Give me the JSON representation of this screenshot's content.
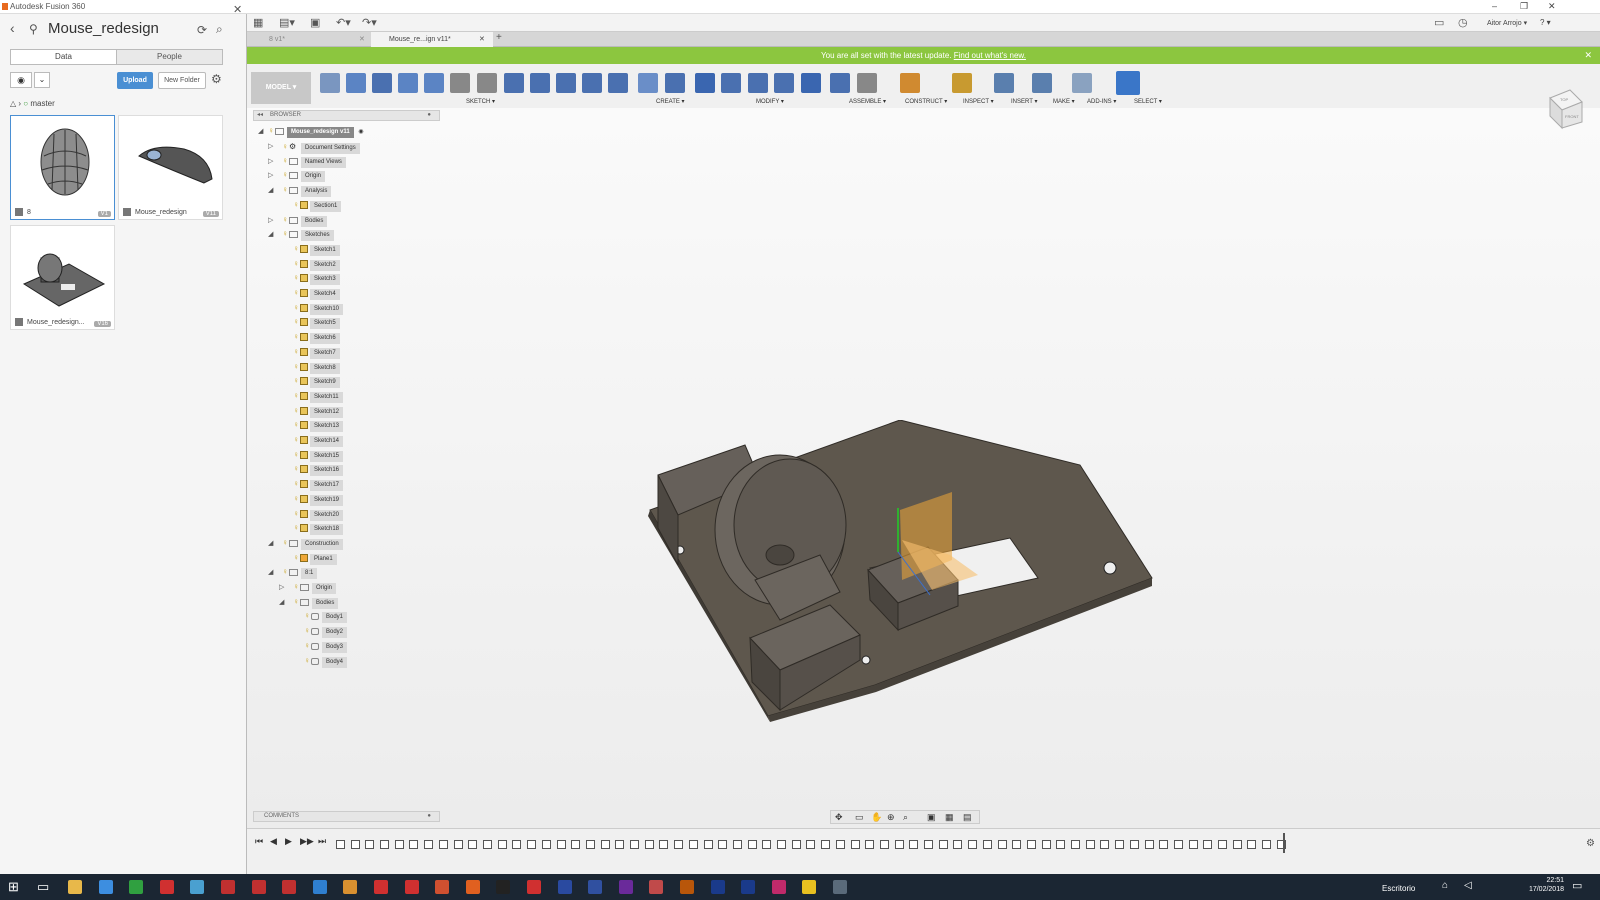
{
  "app_title": "Autodesk Fusion 360",
  "data_panel": {
    "title": "Mouse_redesign",
    "tabs": [
      "Data",
      "People"
    ],
    "upload_label": "Upload",
    "new_folder_label": "New Folder",
    "breadcrumb": "master",
    "items": [
      {
        "name": "8",
        "version": "V1"
      },
      {
        "name": "Mouse_redesign",
        "version": "V11"
      },
      {
        "name": "Mouse_redesign...",
        "version": "V16"
      }
    ]
  },
  "topbar": {
    "user": "Aitor Arrojo ▾",
    "help": "? ▾"
  },
  "doc_tabs": [
    {
      "label": "8 v1*"
    },
    {
      "label": "Mouse_re...ign v11*"
    }
  ],
  "update_bar": {
    "text": "You are all set with the latest update.",
    "link": "Find out what's new."
  },
  "toolbar": {
    "workspace": "MODEL ▾",
    "groups": [
      "SKETCH ▾",
      "CREATE ▾",
      "MODIFY ▾",
      "ASSEMBLE ▾",
      "CONSTRUCT ▾",
      "INSPECT ▾",
      "INSERT ▾",
      "MAKE ▾",
      "ADD-INS ▾",
      "SELECT ▾"
    ]
  },
  "browser": {
    "header": "BROWSER",
    "root": "Mouse_redesign v11",
    "nodes": [
      {
        "label": "Document Settings",
        "level": 1,
        "exp": "▷",
        "kind": "gear"
      },
      {
        "label": "Named Views",
        "level": 1,
        "exp": "▷",
        "kind": "folder"
      },
      {
        "label": "Origin",
        "level": 1,
        "exp": "▷",
        "kind": "folder"
      },
      {
        "label": "Analysis",
        "level": 1,
        "exp": "◢",
        "kind": "folder"
      },
      {
        "label": "Section1",
        "level": 2,
        "exp": "",
        "kind": "sk"
      },
      {
        "label": "Bodies",
        "level": 1,
        "exp": "▷",
        "kind": "folder"
      },
      {
        "label": "Sketches",
        "level": 1,
        "exp": "◢",
        "kind": "folder"
      },
      {
        "label": "Sketch1",
        "level": 2,
        "exp": "",
        "kind": "sk"
      },
      {
        "label": "Sketch2",
        "level": 2,
        "exp": "",
        "kind": "sk"
      },
      {
        "label": "Sketch3",
        "level": 2,
        "exp": "",
        "kind": "sk"
      },
      {
        "label": "Sketch4",
        "level": 2,
        "exp": "",
        "kind": "sk"
      },
      {
        "label": "Sketch10",
        "level": 2,
        "exp": "",
        "kind": "sk"
      },
      {
        "label": "Sketch5",
        "level": 2,
        "exp": "",
        "kind": "sk"
      },
      {
        "label": "Sketch6",
        "level": 2,
        "exp": "",
        "kind": "sk"
      },
      {
        "label": "Sketch7",
        "level": 2,
        "exp": "",
        "kind": "sk"
      },
      {
        "label": "Sketch8",
        "level": 2,
        "exp": "",
        "kind": "sk"
      },
      {
        "label": "Sketch9",
        "level": 2,
        "exp": "",
        "kind": "sk"
      },
      {
        "label": "Sketch11",
        "level": 2,
        "exp": "",
        "kind": "sk"
      },
      {
        "label": "Sketch12",
        "level": 2,
        "exp": "",
        "kind": "sk"
      },
      {
        "label": "Sketch13",
        "level": 2,
        "exp": "",
        "kind": "sk"
      },
      {
        "label": "Sketch14",
        "level": 2,
        "exp": "",
        "kind": "sk"
      },
      {
        "label": "Sketch15",
        "level": 2,
        "exp": "",
        "kind": "sk"
      },
      {
        "label": "Sketch16",
        "level": 2,
        "exp": "",
        "kind": "sk"
      },
      {
        "label": "Sketch17",
        "level": 2,
        "exp": "",
        "kind": "sk"
      },
      {
        "label": "Sketch19",
        "level": 2,
        "exp": "",
        "kind": "sk"
      },
      {
        "label": "Sketch20",
        "level": 2,
        "exp": "",
        "kind": "sk"
      },
      {
        "label": "Sketch18",
        "level": 2,
        "exp": "",
        "kind": "sk"
      },
      {
        "label": "Construction",
        "level": 1,
        "exp": "◢",
        "kind": "folder"
      },
      {
        "label": "Plane1",
        "level": 2,
        "exp": "",
        "kind": "plane"
      },
      {
        "label": "8:1",
        "level": 1,
        "exp": "◢",
        "kind": "comp"
      },
      {
        "label": "Origin",
        "level": 2,
        "exp": "▷",
        "kind": "folder"
      },
      {
        "label": "Bodies",
        "level": 2,
        "exp": "◢",
        "kind": "folder"
      },
      {
        "label": "Body1",
        "level": 3,
        "exp": "",
        "kind": "body"
      },
      {
        "label": "Body2",
        "level": 3,
        "exp": "",
        "kind": "body"
      },
      {
        "label": "Body3",
        "level": 3,
        "exp": "",
        "kind": "body"
      },
      {
        "label": "Body4",
        "level": 3,
        "exp": "",
        "kind": "body"
      }
    ]
  },
  "comments_label": "COMMENTS",
  "viewcube": {
    "top": "TOP",
    "front": "FRONT"
  },
  "taskbar": {
    "desktop": "Escritorio",
    "time": "22:51",
    "date": "17/02/2018"
  },
  "colors": {
    "accent": "#4a8fd3",
    "update_bar": "#8cc63f",
    "model": "#5e574d",
    "highlight": "#f0a838"
  }
}
